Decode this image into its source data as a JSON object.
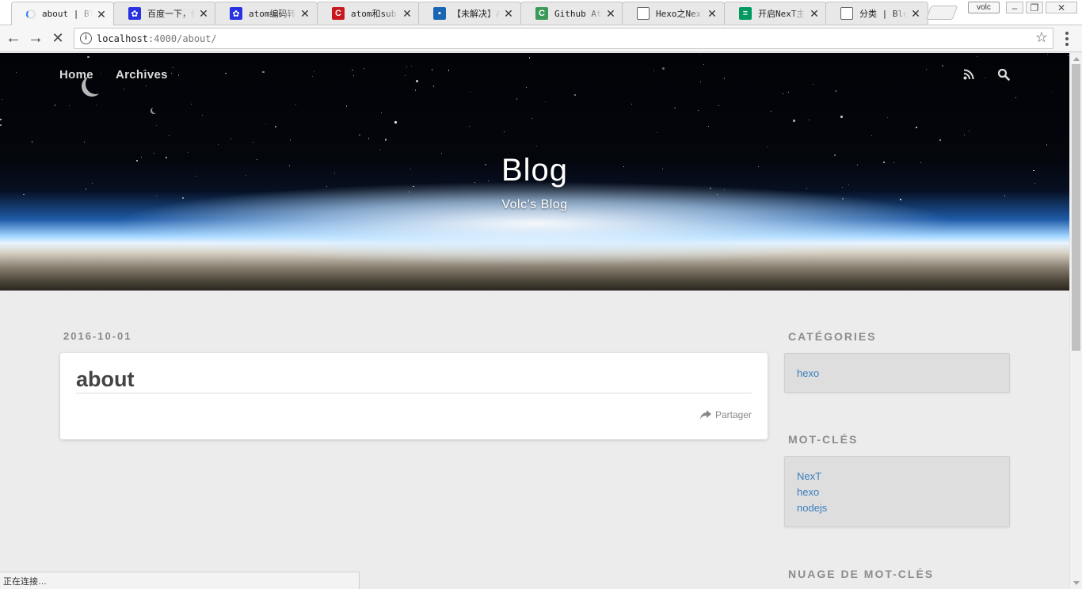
{
  "tabs": [
    {
      "title": "about | Blog",
      "active": true,
      "favicon": "loading-spinner-icon",
      "color": "#2b7de9"
    },
    {
      "title": "百度一下，你就知道",
      "favicon": "baidu-paw-icon",
      "color": "#2932e1"
    },
    {
      "title": "atom编码转换",
      "favicon": "baidu-paw-icon",
      "color": "#2932e1"
    },
    {
      "title": "atom和sublime",
      "favicon": "csdn-c-icon",
      "color": "#c9171e"
    },
    {
      "title": "【未解决】Atom",
      "favicon": "cnblogs-icon",
      "color": "#1a66b3"
    },
    {
      "title": "Github Atom",
      "favicon": "green-c-icon",
      "color": "#3b9a57"
    },
    {
      "title": "Hexo之NexT主题",
      "favicon": "page-icon",
      "color": "#666666"
    },
    {
      "title": "开启NexT主题",
      "favicon": "segmentfault-icon",
      "color": "#009a61"
    },
    {
      "title": "分类 | Blog",
      "favicon": "page-icon",
      "color": "#666666"
    }
  ],
  "profile_label": "volc",
  "window_controls": [
    "minimize-icon",
    "restore-icon",
    "close-icon"
  ],
  "address": {
    "host": "localhost",
    "rest": ":4000/about/"
  },
  "hero": {
    "nav": [
      {
        "label": "Home"
      },
      {
        "label": "Archives"
      }
    ],
    "title": "Blog",
    "subtitle": "Volc's Blog"
  },
  "post": {
    "date": "2016-10-01",
    "title": "about",
    "share_label": "Partager"
  },
  "sidebar": {
    "categories_heading": "CATÉGORIES",
    "categories": [
      "hexo"
    ],
    "tags_heading": "MOT-CLÉS",
    "tags": [
      "NexT",
      "hexo",
      "nodejs"
    ],
    "cloud_heading": "NUAGE DE MOT-CLÉS"
  },
  "status_text": "正在连接…",
  "colors": {
    "link": "#3a7fbd",
    "heading": "#8c8c8c",
    "page_bg": "#ececec"
  }
}
